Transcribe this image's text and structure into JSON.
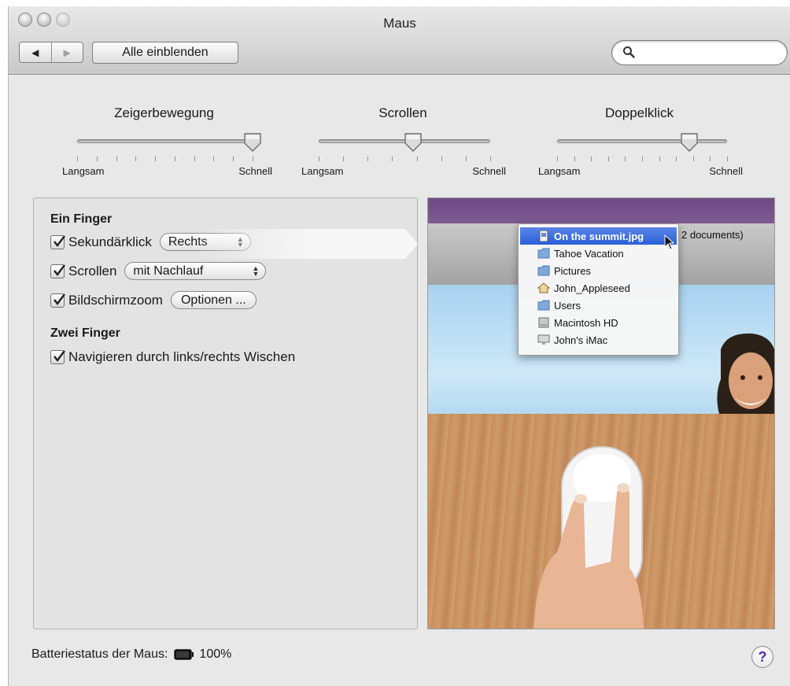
{
  "window": {
    "title": "Maus"
  },
  "toolbar": {
    "back_icon": "back-arrow-icon",
    "forward_icon": "forward-arrow-icon",
    "show_all_label": "Alle einblenden",
    "search_placeholder": "",
    "search_value": ""
  },
  "sliders": [
    {
      "label": "Zeigerbewegung",
      "min_label": "Langsam",
      "max_label": "Schnell",
      "position_fraction": 1.0,
      "tick_count": 10
    },
    {
      "label": "Scrollen",
      "min_label": "Langsam",
      "max_label": "Schnell",
      "position_fraction": 0.55,
      "tick_count": 8
    },
    {
      "label": "Doppelklick",
      "min_label": "Langsam",
      "max_label": "Schnell",
      "position_fraction": 0.78,
      "tick_count": 11
    }
  ],
  "settings": {
    "one_finger_heading": "Ein Finger",
    "secondary_click": {
      "label": "Sekundärklick",
      "checked": true,
      "value": "Rechts"
    },
    "scrolling": {
      "label": "Scrollen",
      "checked": true,
      "value": "mit Nachlauf"
    },
    "screen_zoom": {
      "label": "Bildschirmzoom",
      "checked": true,
      "button_label": "Optionen ..."
    },
    "two_finger_heading": "Zwei Finger",
    "swipe_navigate": {
      "label": "Navigieren durch links/rechts Wischen",
      "checked": true
    }
  },
  "preview": {
    "documents_text": "2 documents)",
    "menu_items": [
      {
        "label": "On the summit.jpg",
        "icon": "file-icon",
        "selected": true
      },
      {
        "label": "Tahoe Vacation",
        "icon": "folder-icon",
        "selected": false
      },
      {
        "label": "Pictures",
        "icon": "folder-icon",
        "selected": false
      },
      {
        "label": "John_Appleseed",
        "icon": "home-icon",
        "selected": false
      },
      {
        "label": "Users",
        "icon": "folder-icon",
        "selected": false
      },
      {
        "label": "Macintosh HD",
        "icon": "harddisk-icon",
        "selected": false
      },
      {
        "label": "John's iMac",
        "icon": "computer-icon",
        "selected": false
      }
    ]
  },
  "battery": {
    "label": "Batteriestatus der Maus:",
    "percent": "100%"
  },
  "help": {
    "label": "?"
  },
  "colors": {
    "selection": "#2a5fd8",
    "help": "#5b2bb0",
    "window_bg": "#e8e8e8"
  }
}
